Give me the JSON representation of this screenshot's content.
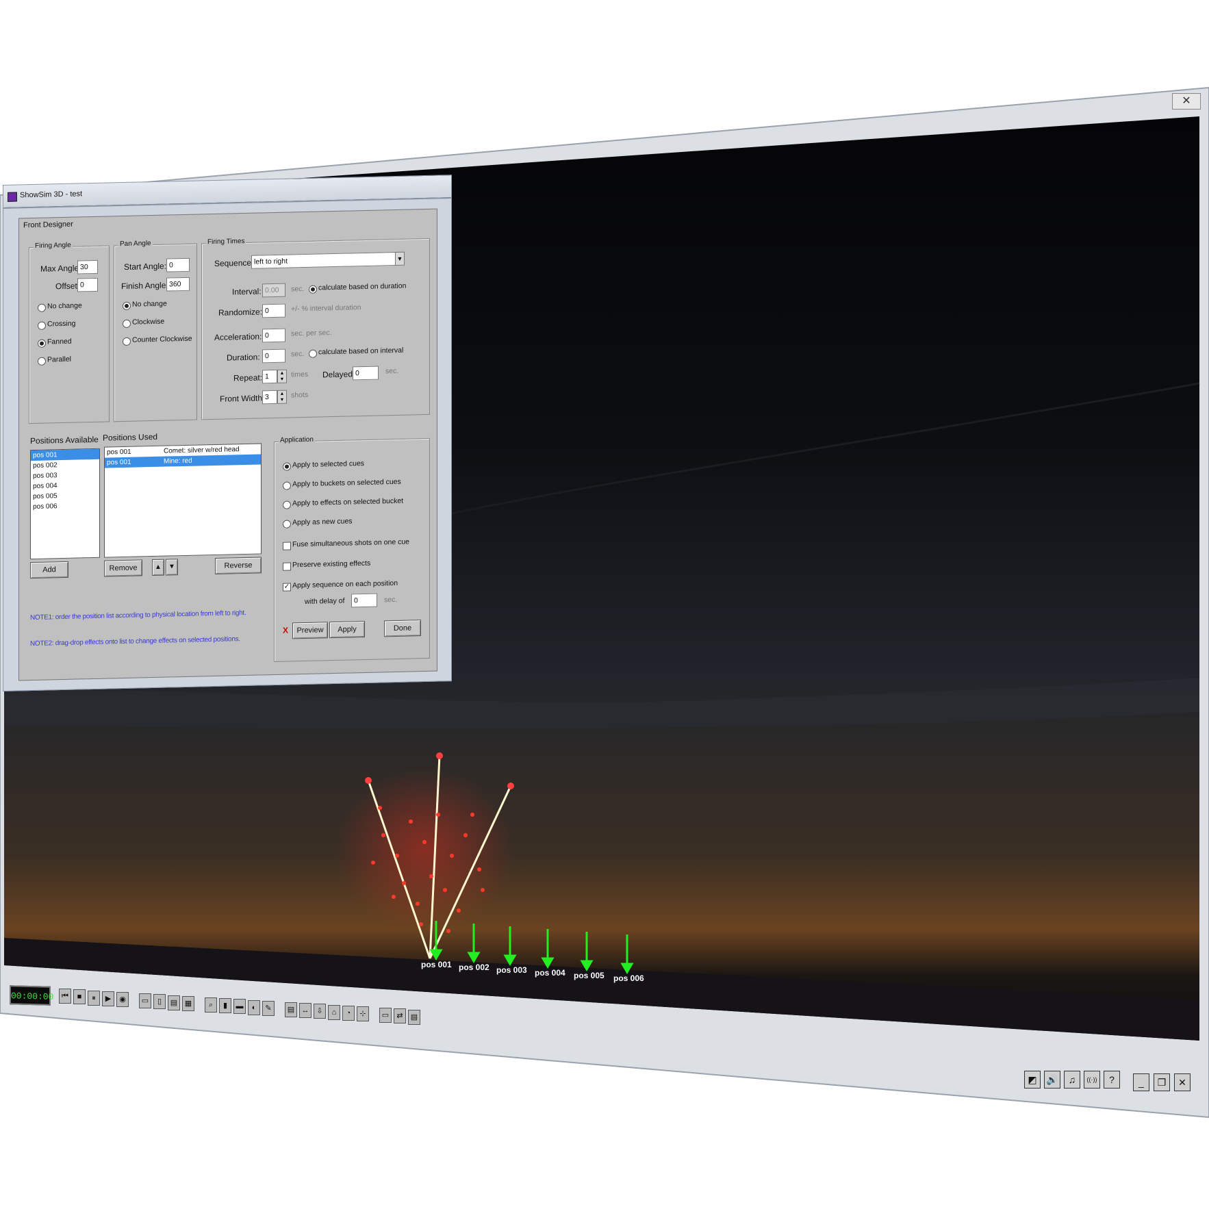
{
  "window": {
    "close_glyph": "✕",
    "app_title": "ShowSim 3D - test"
  },
  "dialog": {
    "title": "Front Designer",
    "firing_angle": {
      "label": "Firing Angle",
      "max_angle_label": "Max Angle:",
      "max_angle_value": "30",
      "offset_label": "Offset:",
      "offset_value": "0",
      "options": [
        "No change",
        "Crossing",
        "Fanned",
        "Parallel"
      ],
      "selected": "Fanned"
    },
    "pan_angle": {
      "label": "Pan Angle",
      "start_label": "Start Angle:",
      "start_value": "0",
      "finish_label": "Finish Angle:",
      "finish_value": "360",
      "options": [
        "No change",
        "Clockwise",
        "Counter Clockwise"
      ],
      "selected": "No change"
    },
    "firing_times": {
      "label": "Firing Times",
      "sequence_label": "Sequence",
      "sequence_value": "left to right",
      "interval_label": "Interval:",
      "interval_value": "0.00",
      "interval_unit": "sec.",
      "calc_duration_label": "calculate based on duration",
      "randomize_label": "Randomize:",
      "randomize_value": "0",
      "randomize_unit": "+/- % interval duration",
      "acceleration_label": "Acceleration:",
      "acceleration_value": "0",
      "acceleration_unit": "sec. per sec.",
      "duration_label": "Duration:",
      "duration_value": "0",
      "duration_unit": "sec.",
      "calc_interval_label": "calculate based on interval",
      "repeat_label": "Repeat:",
      "repeat_value": "1",
      "repeat_unit": "times",
      "delayed_label": "Delayed",
      "delayed_value": "0",
      "delayed_unit": "sec.",
      "front_width_label": "Front Width:",
      "front_width_value": "3",
      "front_width_unit": "shots"
    },
    "positions_available": {
      "label": "Positions Available",
      "items": [
        "pos 001",
        "pos 002",
        "pos 003",
        "pos 004",
        "pos 005",
        "pos 006"
      ],
      "add_button": "Add"
    },
    "positions_used": {
      "label": "Positions Used",
      "rows": [
        {
          "pos": "pos 001",
          "effect": "Comet: silver w/red head"
        },
        {
          "pos": "pos 001",
          "effect": "Mine: red"
        }
      ],
      "remove_button": "Remove",
      "up_glyph": "▲",
      "down_glyph": "▼",
      "reverse_button": "Reverse"
    },
    "application": {
      "label": "Application",
      "options": [
        "Apply to selected cues",
        "Apply to buckets on selected cues",
        "Apply to effects on selected bucket",
        "Apply as new cues"
      ],
      "selected": "Apply to selected cues",
      "fuse_label": "Fuse simultaneous shots on one cue",
      "preserve_label": "Preserve existing effects",
      "apply_seq_label": "Apply sequence on each position",
      "with_delay_label": "with delay of",
      "delay_value": "0",
      "delay_unit": "sec.",
      "x_label": "X",
      "preview_button": "Preview",
      "apply_button": "Apply",
      "done_button": "Done"
    },
    "note1": "NOTE1: order the position list according to physical location from left to right.",
    "note2": "NOTE2: drag-drop effects onto list to change effects on selected positions."
  },
  "scene": {
    "positions": [
      "pos 001",
      "pos 002",
      "pos 003",
      "pos 004",
      "pos 005",
      "pos 006"
    ],
    "timecode": "00:00:00"
  },
  "toolbar": {
    "groups": [
      [
        "⏮",
        "■",
        "⏸",
        "▶",
        "◉"
      ],
      [
        "▭",
        "▯",
        "▤",
        "▦"
      ],
      [
        "⌕",
        "▮",
        "▬",
        "◐",
        "✎"
      ],
      [
        "▤",
        "↔",
        "⇩",
        "⌂",
        "◔",
        "⊹"
      ],
      [
        "▭",
        "⇄",
        "▤"
      ]
    ],
    "right_icons": [
      "◩",
      "🔊",
      "♫",
      "((·))",
      "?"
    ],
    "window_controls": [
      "_",
      "❐",
      "✕"
    ]
  }
}
